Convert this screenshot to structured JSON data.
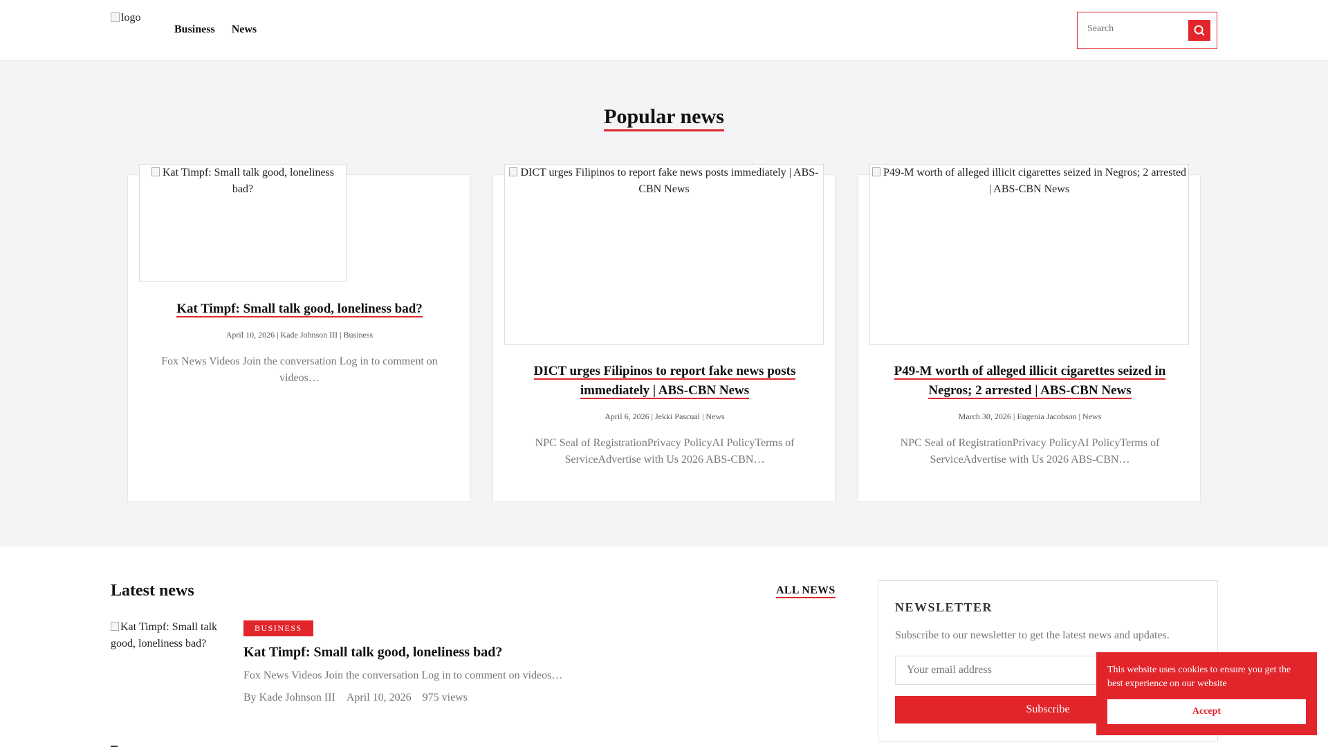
{
  "header": {
    "logo_alt": "logo",
    "nav": [
      "Business",
      "News"
    ],
    "search_placeholder": "Search"
  },
  "popular": {
    "title": "Popular news",
    "cards": [
      {
        "image_alt": "Kat Timpf: Small talk good, loneliness bad?",
        "title": "Kat Timpf: Small talk good, loneliness bad?",
        "meta": "April 10, 2026 | Kade Johnson III | Business",
        "excerpt": "Fox News Videos Join the conversation Log in to comment on videos…"
      },
      {
        "image_alt": "DICT urges Filipinos to report fake news posts immediately | ABS-CBN News",
        "title": "DICT urges Filipinos to report fake news posts immediately | ABS-CBN News",
        "meta": "April 6, 2026 | Jekki Pascual | News",
        "excerpt": "NPC Seal of RegistrationPrivacy PolicyAI PolicyTerms of ServiceAdvertise with Us 2026 ABS-CBN…"
      },
      {
        "image_alt": "P49-M worth of alleged illicit cigarettes seized in Negros; 2 arrested | ABS-CBN News",
        "title": "P49-M worth of alleged illicit cigarettes seized in Negros; 2 arrested | ABS-CBN News",
        "meta": "March 30, 2026 | Eugenia Jacobson | News",
        "excerpt": "NPC Seal of RegistrationPrivacy PolicyAI PolicyTerms of ServiceAdvertise with Us 2026 ABS-CBN…"
      }
    ]
  },
  "latest": {
    "title": "Latest news",
    "all_link": "ALL NEWS",
    "item": {
      "image_alt": "Kat Timpf: Small talk good, loneliness bad?",
      "category": "BUSINESS",
      "title": "Kat Timpf: Small talk good, loneliness bad?",
      "excerpt": "Fox News Videos Join the conversation Log in to comment on videos…",
      "author": "By Kade Johnson III",
      "date": "April 10, 2026",
      "views": "975 views"
    }
  },
  "newsletter": {
    "title": "NEWSLETTER",
    "text": "Subscribe to our newsletter to get the latest news and updates.",
    "email_placeholder": "Your email address",
    "button": "Subscribe"
  },
  "cookie": {
    "text": "This website uses cookies to ensure you get the best experience on our website",
    "button": "Accept"
  },
  "colors": {
    "accent": "#e1252b",
    "section_bg": "#f3f4f6"
  }
}
